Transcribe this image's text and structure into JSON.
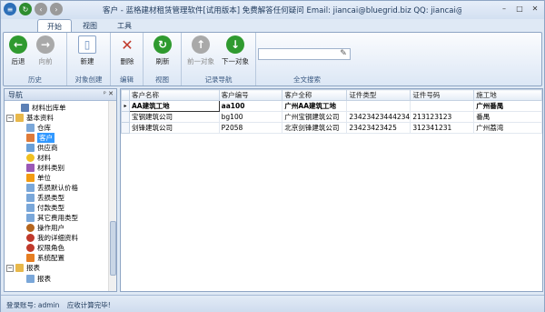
{
  "window": {
    "title": "客户 - 蓝格建材租赁管理软件[试用版本] 免费解答任何疑问 Email: jiancai@bluegrid.biz QQ: jiancai@blu...",
    "controls": [
      "–",
      "□",
      "✕"
    ]
  },
  "ribbon": {
    "tabs": [
      "开始",
      "视图",
      "工具"
    ],
    "active_tab": "开始",
    "groups": {
      "history": {
        "label": "历史",
        "back": "后退",
        "forward": "向前"
      },
      "create": {
        "label": "对象创建",
        "new": "新建"
      },
      "edit": {
        "label": "编辑",
        "delete": "删除"
      },
      "view": {
        "label": "视图",
        "refresh": "刷新"
      },
      "record_nav": {
        "label": "记录导航",
        "prev": "前一对象",
        "next": "下一对象"
      },
      "search": {
        "label": "全文搜索",
        "value": ""
      }
    }
  },
  "nav": {
    "header": "导航",
    "header_controls": "ᵖ ✕",
    "items": [
      {
        "label": "材料出库单"
      },
      {
        "label": "基本资料"
      },
      {
        "label": "仓库"
      },
      {
        "label": "客户"
      },
      {
        "label": "供应商"
      },
      {
        "label": "材料"
      },
      {
        "label": "材料类别"
      },
      {
        "label": "单位"
      },
      {
        "label": "丢损默认价格"
      },
      {
        "label": "丢损类型"
      },
      {
        "label": "付款类型"
      },
      {
        "label": "其它费用类型"
      },
      {
        "label": "操作用户"
      },
      {
        "label": "我的详细资料"
      },
      {
        "label": "权限角色"
      },
      {
        "label": "系统配置"
      },
      {
        "label": "报表"
      },
      {
        "label": "报表"
      }
    ]
  },
  "grid": {
    "columns": [
      "客户名称",
      "客户编号",
      "客户全称",
      "证件类型",
      "证件号码",
      "施工地"
    ],
    "rows": [
      {
        "indicator": "▸",
        "cells": [
          "AA建筑工地",
          "aa100",
          "广州AA建筑工地",
          "",
          "",
          "广州番禺"
        ]
      },
      {
        "indicator": "",
        "cells": [
          "宝钢建筑公司",
          "bg100",
          "广州宝钢建筑公司",
          "23423423444234",
          "213123123",
          "番禺"
        ]
      },
      {
        "indicator": "",
        "cells": [
          "剑锋建筑公司",
          "P2058",
          "北京剑锋建筑公司",
          "23423423425",
          "312341231",
          "广州荔湾"
        ]
      }
    ]
  },
  "status": {
    "user": "登录账号: admin",
    "message": "应收计算完毕!"
  }
}
